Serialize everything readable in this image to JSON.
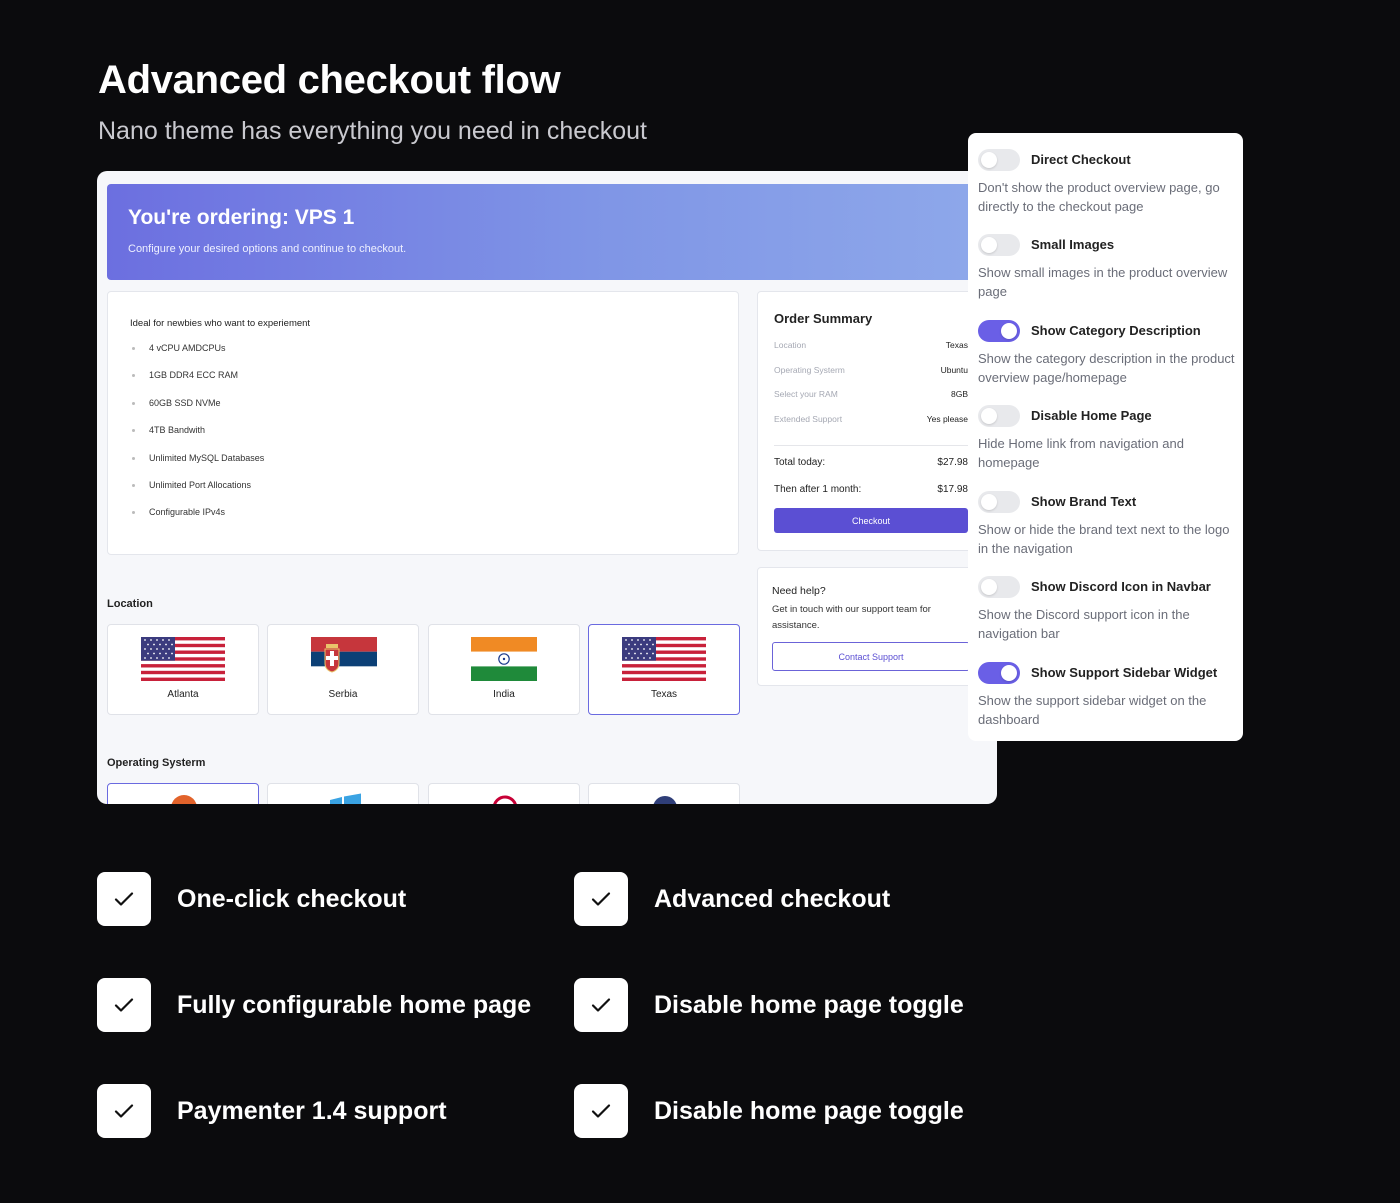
{
  "hero": {
    "title": "Advanced checkout flow",
    "subtitle": "Nano theme has everything you need in checkout"
  },
  "banner": {
    "title": "You're ordering: VPS 1",
    "subtitle": "Configure your desired options and continue to checkout."
  },
  "plan": {
    "title": "Ideal for newbies who want to experiement",
    "features": [
      "4 vCPU AMDCPUs",
      "1GB DDR4 ECC RAM",
      "60GB SSD NVMe",
      "4TB Bandwith",
      "Unlimited MySQL Databases",
      "Unlimited Port Allocations",
      "Configurable IPv4s"
    ]
  },
  "summary": {
    "title": "Order Summary",
    "rows": [
      {
        "key": "Location",
        "value": "Texas"
      },
      {
        "key": "Operating Systerm",
        "value": "Ubuntu"
      },
      {
        "key": "Select your RAM",
        "value": "8GB"
      },
      {
        "key": "Extended Support",
        "value": "Yes please"
      }
    ],
    "total_today_label": "Total today:",
    "total_today_value": "$27.98",
    "then_label": "Then after 1 month:",
    "then_value": "$17.98",
    "checkout_label": "Checkout"
  },
  "help": {
    "title": "Need help?",
    "text": "Get in touch with our support team for assistance.",
    "button_label": "Contact Support"
  },
  "location": {
    "label": "Location",
    "options": [
      {
        "name": "Atlanta",
        "flag": "usa-flag",
        "selected": false
      },
      {
        "name": "Serbia",
        "flag": "serbia-flag",
        "selected": false
      },
      {
        "name": "India",
        "flag": "india-flag",
        "selected": false
      },
      {
        "name": "Texas",
        "flag": "usa-flag",
        "selected": true
      }
    ]
  },
  "os": {
    "label": "Operating Systerm",
    "options": [
      {
        "icon": "ubuntu-icon",
        "selected": true
      },
      {
        "icon": "windows-icon",
        "selected": false
      },
      {
        "icon": "debian-icon",
        "selected": false
      },
      {
        "icon": "fedora-icon",
        "selected": false
      }
    ]
  },
  "settings": [
    {
      "label": "Direct Checkout",
      "desc": "Don't show the product overview page, go directly to the checkout page",
      "on": false
    },
    {
      "label": "Small Images",
      "desc": "Show small images in the product overview page",
      "on": false
    },
    {
      "label": "Show Category Description",
      "desc": "Show the category description in the product overview page/homepage",
      "on": true
    },
    {
      "label": "Disable Home Page",
      "desc": "Hide Home link from navigation and homepage",
      "on": false
    },
    {
      "label": "Show Brand Text",
      "desc": "Show or hide the brand text next to the logo in the navigation",
      "on": false
    },
    {
      "label": "Show Discord Icon in Navbar",
      "desc": "Show the Discord support icon in the navigation bar",
      "on": false
    },
    {
      "label": "Show Support Sidebar Widget",
      "desc": "Show the support sidebar widget on the dashboard",
      "on": true
    }
  ],
  "checklist": [
    "One-click checkout",
    "Advanced checkout",
    "Fully configurable home page",
    "Disable home page toggle",
    "Paymenter 1.4 support",
    "Disable home page toggle"
  ],
  "colors": {
    "accent": "#5b4fd3",
    "toggle_on": "#6a5fe6",
    "page_bg": "#0b0b0d"
  }
}
